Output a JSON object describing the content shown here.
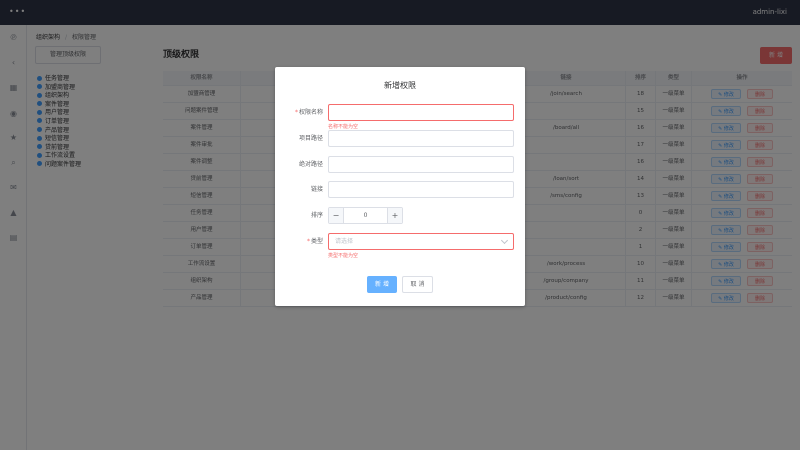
{
  "topbar": {
    "menu_glyph": "•••",
    "user": "admin-lixi"
  },
  "rail": {
    "icons": [
      "fingerprint-icon",
      "share-icon",
      "grid-icon",
      "target-icon",
      "star-icon",
      "search-icon",
      "mail-icon",
      "bell-icon",
      "document-icon"
    ]
  },
  "breadcrumb": {
    "parent": "组织架构",
    "separator": "/",
    "current": "权限管理"
  },
  "left_panel": {
    "top_button": "管理顶级权限",
    "tree": [
      "任务管理",
      "加盟商管理",
      "组织架构",
      "案件管理",
      "用户管理",
      "订单管理",
      "产品管理",
      "短信管理",
      "贷前管理",
      "工作流设置",
      "问题案件管理"
    ]
  },
  "main": {
    "title": "顶级权限",
    "new_button": "新 增",
    "table": {
      "columns": [
        "权限名称",
        "",
        "",
        "链接",
        "排序",
        "类型",
        "操作"
      ],
      "edit_label": "✎ 修改",
      "delete_label": "删除",
      "rows": [
        {
          "name": "加盟商管理",
          "link": "/join/search",
          "sort": "18",
          "type": "一级菜单"
        },
        {
          "name": "问题案件管理",
          "link": "",
          "sort": "15",
          "type": "一级菜单"
        },
        {
          "name": "案件管理",
          "link": "/board/all",
          "sort": "16",
          "type": "一级菜单"
        },
        {
          "name": "案件审批",
          "link": "",
          "sort": "17",
          "type": "一级菜单"
        },
        {
          "name": "案件调整",
          "link": "",
          "sort": "16",
          "type": "一级菜单"
        },
        {
          "name": "贷前管理",
          "link": "/loan/sort",
          "sort": "14",
          "type": "一级菜单"
        },
        {
          "name": "短信管理",
          "link": "/sms/config",
          "sort": "13",
          "type": "一级菜单"
        },
        {
          "name": "任务管理",
          "link": "",
          "sort": "0",
          "type": "一级菜单"
        },
        {
          "name": "用户管理",
          "link": "",
          "sort": "2",
          "type": "一级菜单"
        },
        {
          "name": "订单管理",
          "link": "",
          "sort": "1",
          "type": "一级菜单"
        },
        {
          "name": "工作流设置",
          "link": "/work/process",
          "sort": "10",
          "type": "一级菜单"
        },
        {
          "name": "组织架构",
          "link": "/group/company",
          "sort": "11",
          "type": "一级菜单"
        },
        {
          "name": "产品管理",
          "link": "/product/config",
          "sort": "12",
          "type": "一级菜单"
        }
      ]
    }
  },
  "dialog": {
    "title": "新增权限",
    "fields": {
      "name": {
        "label": "权限名称",
        "value": "",
        "error": "名称不能为空"
      },
      "item_path": {
        "label": "项目路径",
        "value": ""
      },
      "abs_path": {
        "label": "绝对路径",
        "value": ""
      },
      "link": {
        "label": "链接",
        "value": ""
      },
      "sort": {
        "label": "排序",
        "value": "0",
        "minus": "−",
        "plus": "+"
      },
      "type": {
        "label": "类型",
        "placeholder": "请选择",
        "error": "类型不能为空"
      }
    },
    "ok_button": "新 增",
    "cancel_button": "取 消"
  },
  "colors": {
    "topbar": "#2f3447",
    "primary": "#409eff",
    "danger": "#f56c6c"
  }
}
